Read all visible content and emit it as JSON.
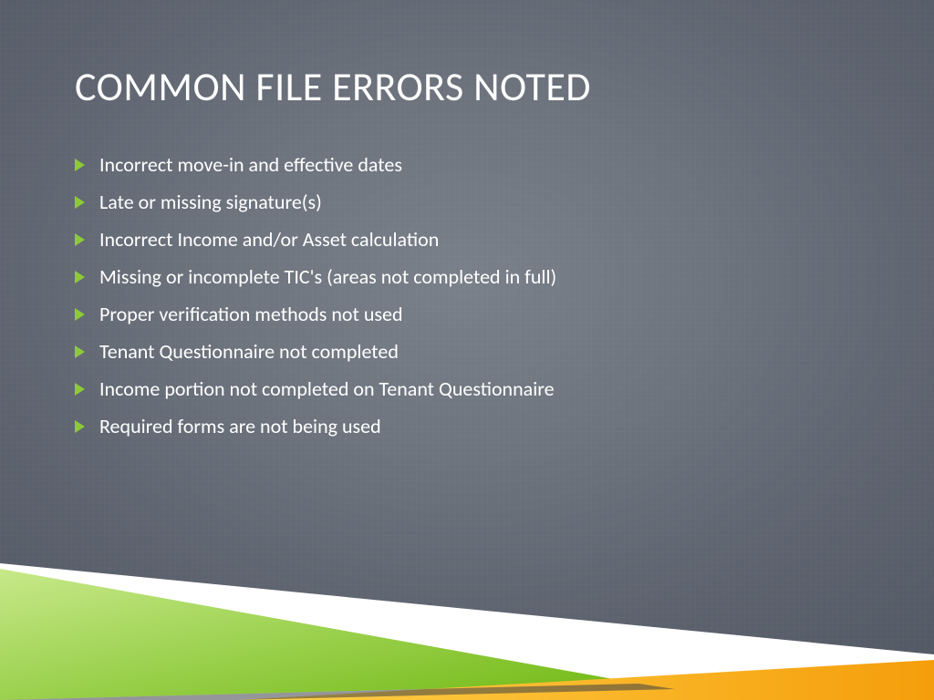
{
  "title": "COMMON FILE ERRORS NOTED",
  "bullets": [
    "Incorrect move-in and effective dates",
    "Late or missing signature(s)",
    "Incorrect Income and/or Asset calculation",
    "Missing or incomplete TIC's (areas not completed in full)",
    "Proper verification methods not used",
    "Tenant Questionnaire not completed",
    "Income portion not completed on Tenant Questionnaire",
    "Required forms are not being used"
  ],
  "colors": {
    "bullet_arrow": "#8fc93a",
    "accent_green_light": "#c7e98a",
    "accent_green_dark": "#6fb811",
    "accent_orange_light": "#ffd24a",
    "accent_orange_dark": "#f59e0b",
    "white": "#ffffff"
  }
}
